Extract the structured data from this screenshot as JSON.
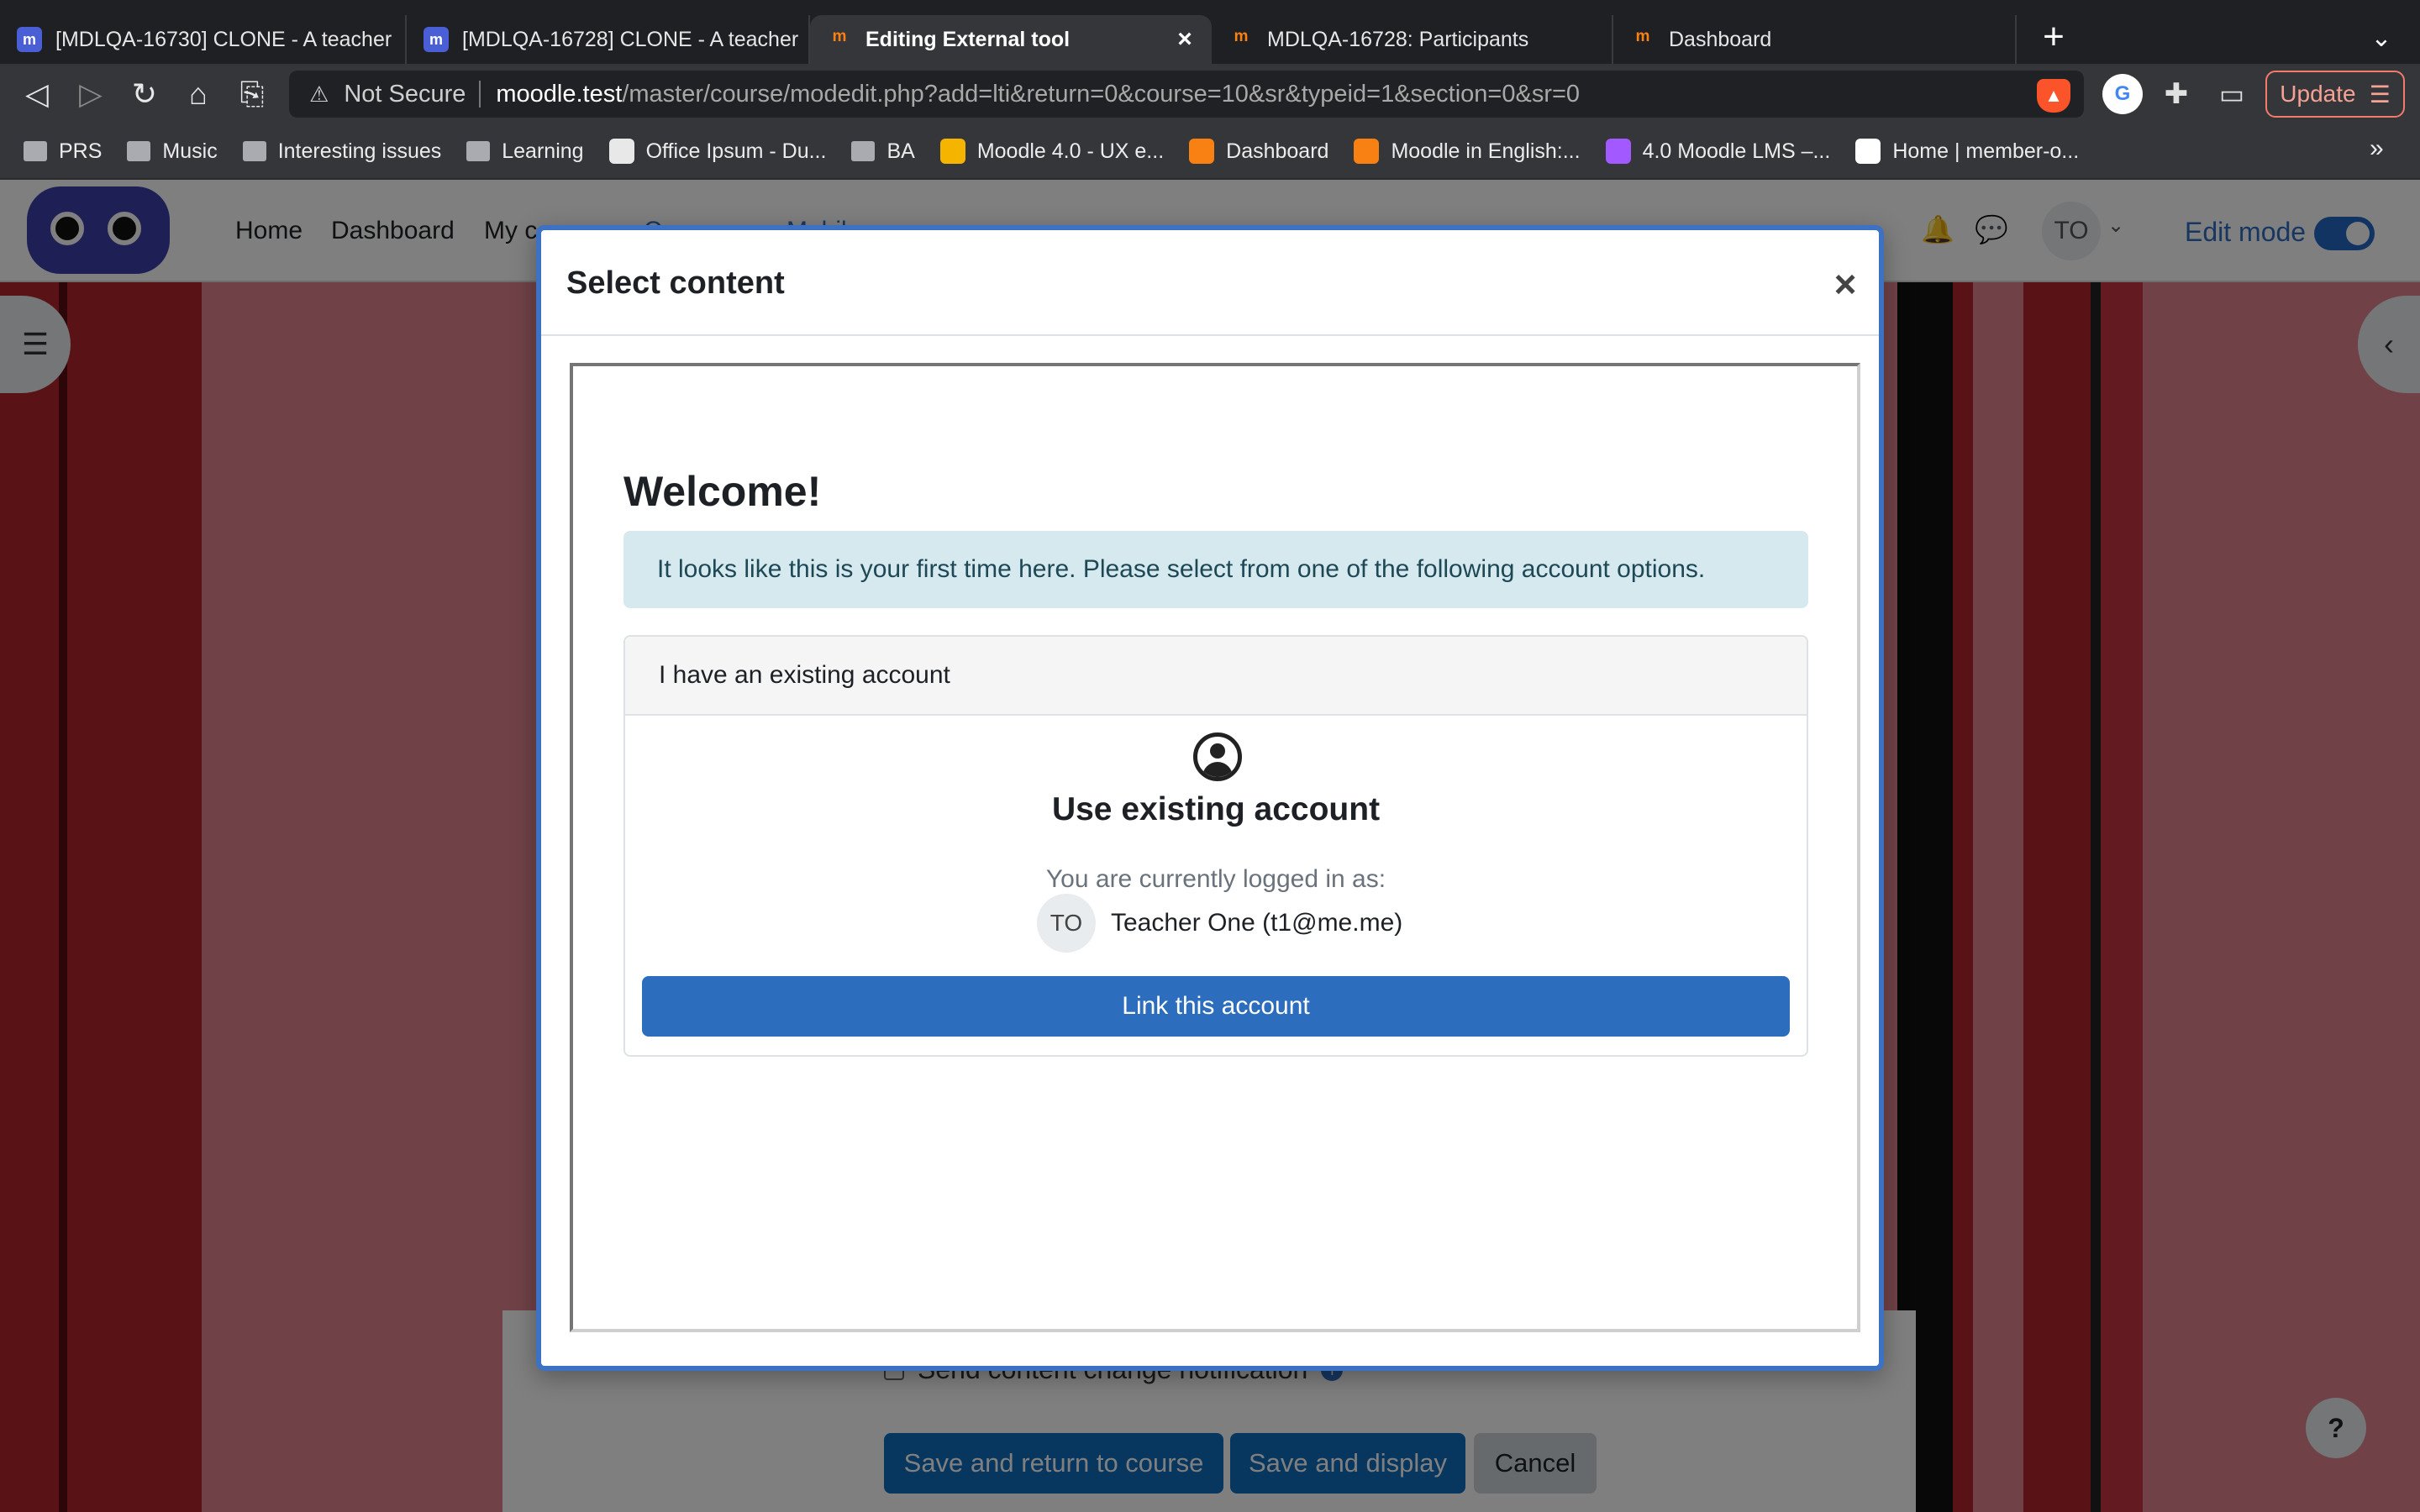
{
  "browser": {
    "tabs": [
      {
        "title": "[MDLQA-16730] CLONE - A teacher",
        "favicon": "moodle-tracker"
      },
      {
        "title": "[MDLQA-16728] CLONE - A teacher",
        "favicon": "moodle-tracker"
      },
      {
        "title": "Editing External tool",
        "favicon": "moodle",
        "active": true,
        "close": "×"
      },
      {
        "title": "MDLQA-16728: Participants",
        "favicon": "moodle"
      },
      {
        "title": "Dashboard",
        "favicon": "moodle"
      }
    ],
    "new_tab": "+",
    "tab_menu": "⌄",
    "nav": {
      "back": "◁",
      "forward": "▷",
      "reload": "↻",
      "home": "⌂",
      "bookmark": "⎘"
    },
    "address": {
      "security": "Not Secure",
      "host": "moodle.test",
      "path": "/master/course/modedit.php?add=lti&return=0&course=10&sr&typeid=1&section=0&sr=0"
    },
    "update_label": "Update",
    "update_icon": "☰",
    "bookmarks": [
      {
        "label": "PRS",
        "icon": "folder"
      },
      {
        "label": "Music",
        "icon": "folder"
      },
      {
        "label": "Interesting issues",
        "icon": "folder"
      },
      {
        "label": "Learning",
        "icon": "folder"
      },
      {
        "label": "Office Ipsum - Du...",
        "icon": "page"
      },
      {
        "label": "BA",
        "icon": "folder"
      },
      {
        "label": "Moodle 4.0 - UX e...",
        "icon": "slides"
      },
      {
        "label": "Dashboard",
        "icon": "moodle"
      },
      {
        "label": "Moodle in English:...",
        "icon": "moodle"
      },
      {
        "label": "4.0 Moodle LMS –...",
        "icon": "figma"
      },
      {
        "label": "Home | member-o...",
        "icon": "wix"
      }
    ],
    "bookmarks_more": "»"
  },
  "moodle": {
    "nav_items": [
      "Home",
      "Dashboard",
      "My courses",
      "Courses",
      "Mobile app"
    ],
    "user_initials": "TO",
    "edit_mode_label": "Edit mode",
    "edit_mode_on": true,
    "form": {
      "notify_label": "Send content change notification",
      "save_return": "Save and return to course",
      "save_display": "Save and display",
      "cancel": "Cancel"
    },
    "help": "?"
  },
  "modal": {
    "title": "Select content",
    "close": "×",
    "welcome": "Welcome!",
    "info": "It looks like this is your first time here. Please select from one of the following account options.",
    "card_header": "I have an existing account",
    "card_heading": "Use existing account",
    "logged_in_text": "You are currently logged in as:",
    "user_initials": "TO",
    "user_name": "Teacher One (t1@me.me)",
    "link_button": "Link this account"
  },
  "colors": {
    "accent": "#0f6cbf",
    "modal_border": "#3d71c4",
    "info_bg": "#d5e9ee",
    "background_pink": "#e0858f",
    "background_red": "#b3262f"
  }
}
